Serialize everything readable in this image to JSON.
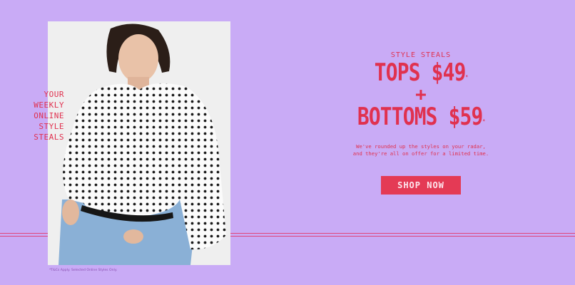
{
  "banner": {
    "side_lines": [
      "YOUR",
      "WEEKLY",
      "ONLINE",
      "STYLE",
      "STEALS"
    ],
    "eyebrow": "STYLE STEALS",
    "headline_top": "TOPS $49",
    "plus": "+",
    "headline_bottom": "BOTTOMS $59",
    "asterisk": "*",
    "copy_lines": [
      "We've rounded up the styles on your radar,",
      "and they're all on offer for a limited time."
    ],
    "cta_label": "SHOP NOW",
    "fineprint": "*T&Cs Apply. Selected Online Styles Only.",
    "colors": {
      "background": "#c9abf6",
      "accent": "#e0314f",
      "button": "#e43a55"
    }
  },
  "photo": {
    "description_icon": "model-polka-dot-shirt-image"
  }
}
